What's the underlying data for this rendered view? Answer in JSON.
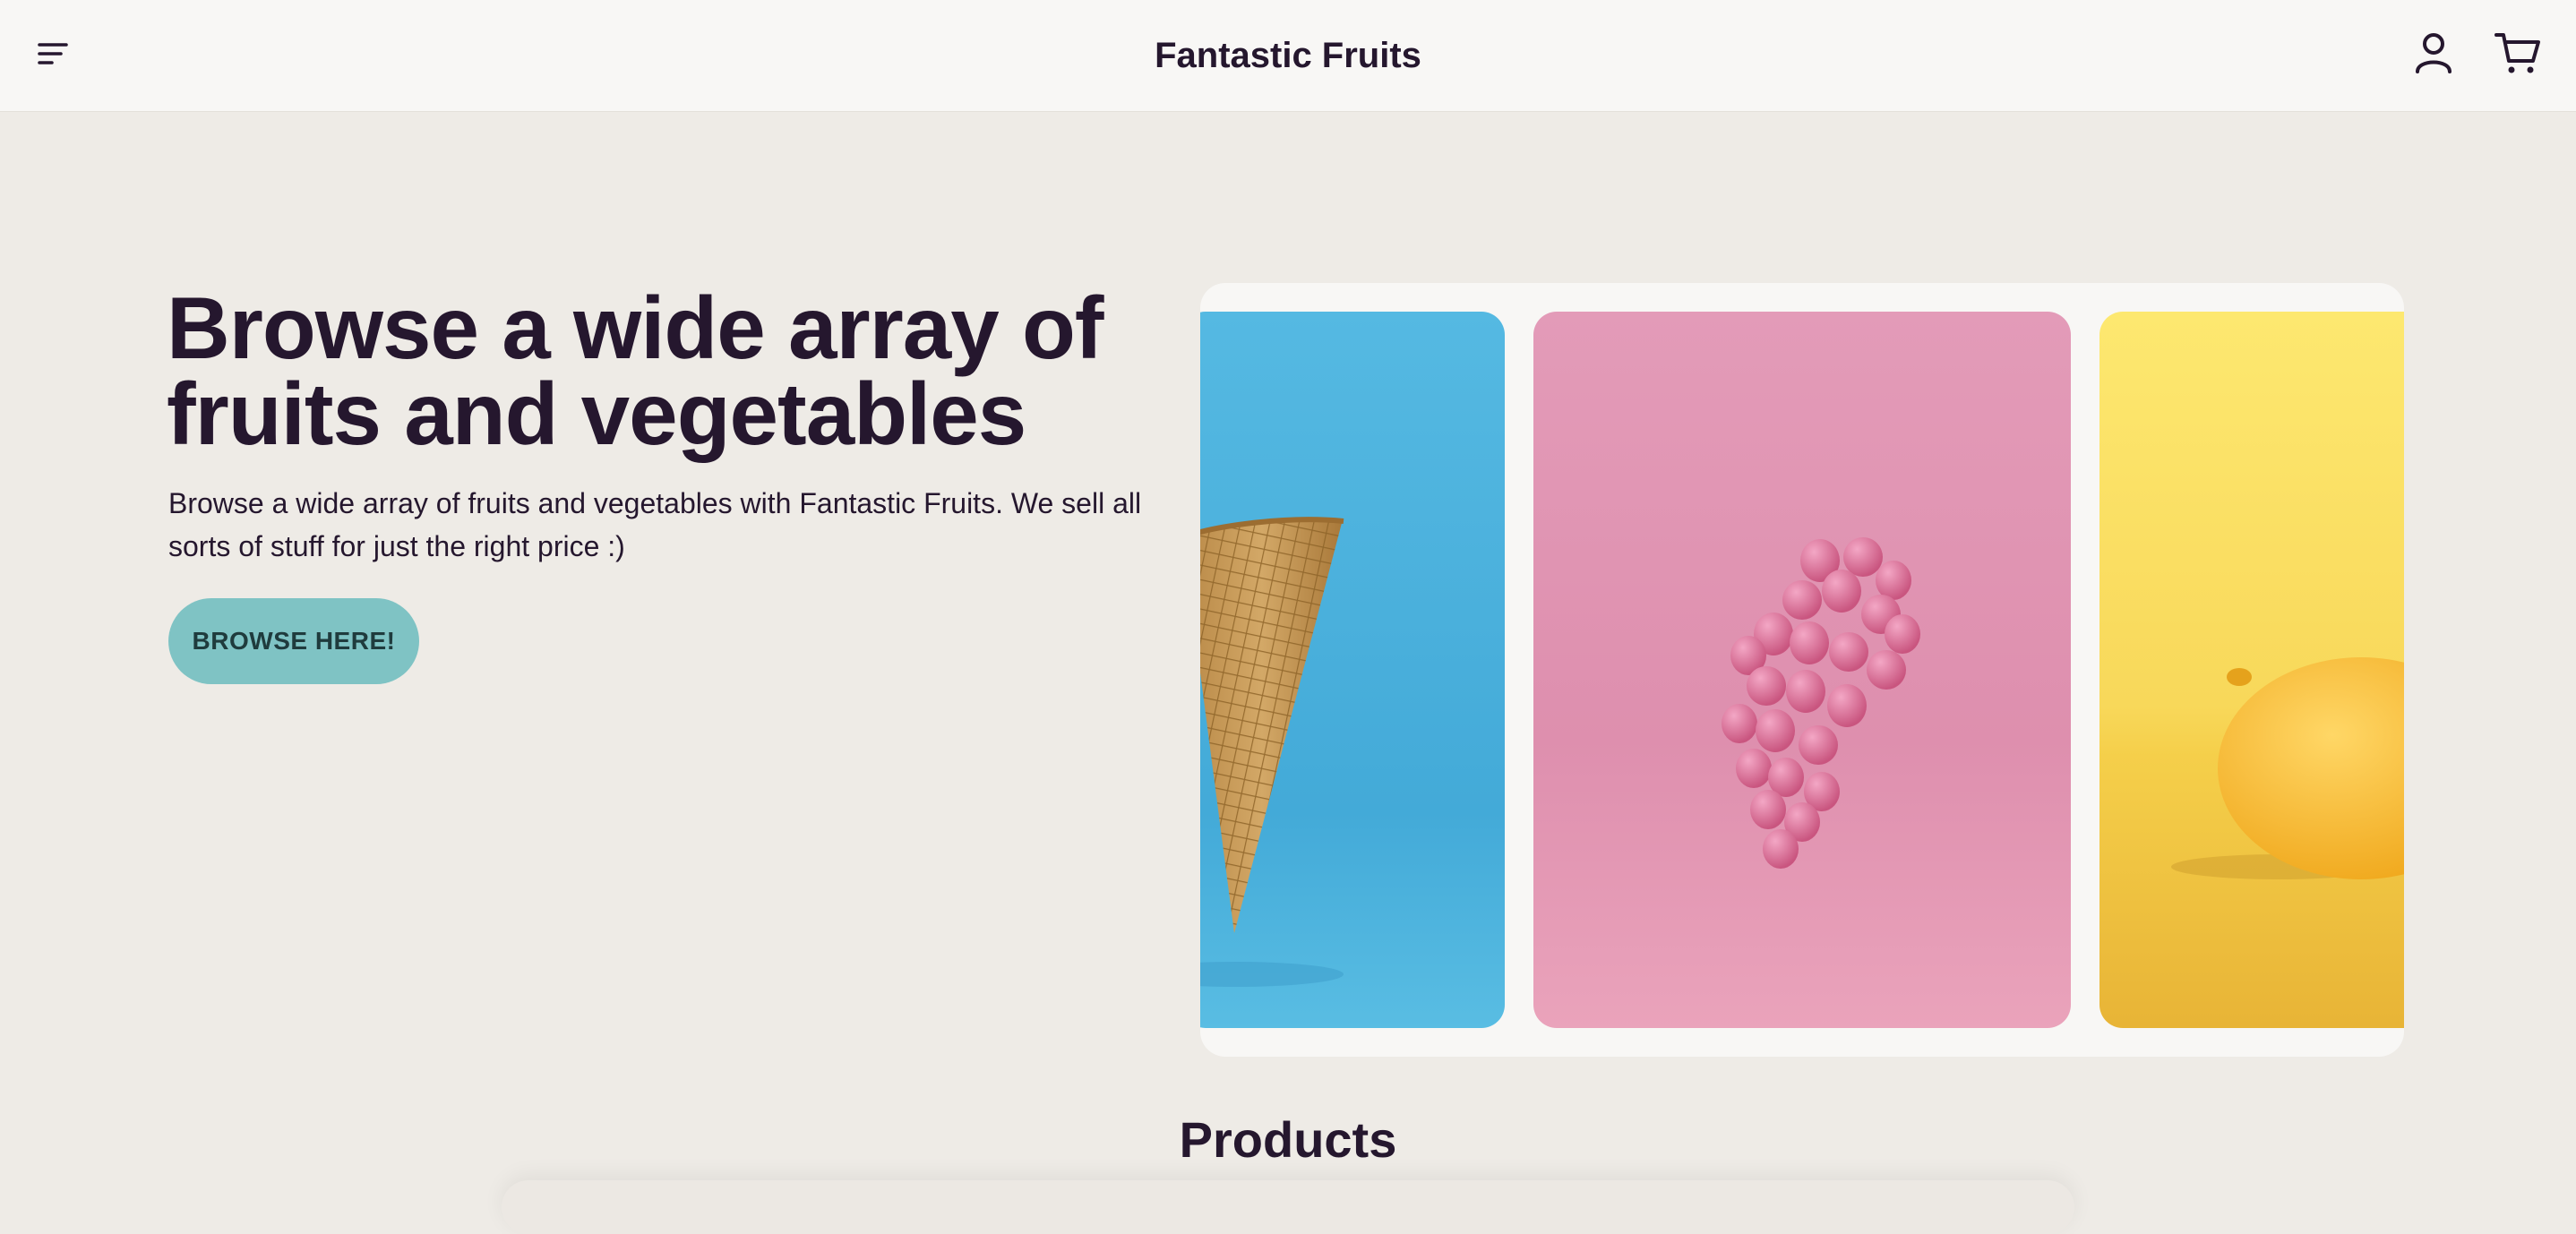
{
  "header": {
    "brand": "Fantastic Fruits",
    "menu_icon": "menu-lines-icon",
    "account_icon": "user-icon",
    "cart_icon": "shopping-cart-icon"
  },
  "hero": {
    "title": "Browse a wide array of fruits and vegetables",
    "description": "Browse a wide array of fruits and vegetables with Fantastic Fruits. We sell all sorts of stuff for just the right price :)",
    "button_label": "BROWSE HERE!"
  },
  "carousel": {
    "slides": [
      {
        "subject": "waffle cone",
        "background": "#4fb6de"
      },
      {
        "subject": "pink grapes",
        "background": "#e195b3"
      },
      {
        "subject": "lemon",
        "background": "#fbe26a"
      }
    ]
  },
  "products": {
    "title": "Products"
  },
  "colors": {
    "page_bg": "#eeebe6",
    "header_bg": "#f8f7f5",
    "text": "#25172e",
    "accent": "#7fc3c4"
  }
}
